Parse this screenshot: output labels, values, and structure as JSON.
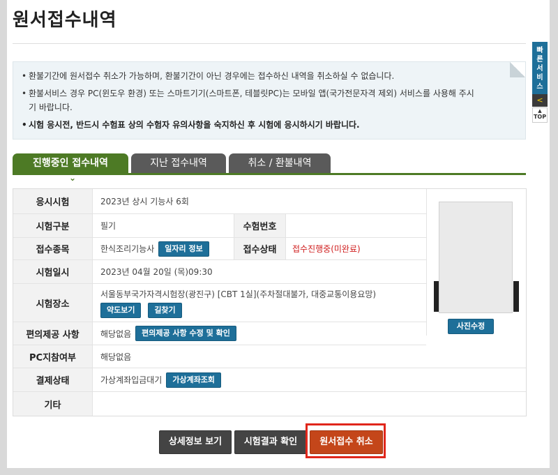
{
  "page_title": "원서접수내역",
  "notices": [
    {
      "text": "환불기간에 원서접수 취소가 가능하며, 환불기간이 아닌 경우에는 접수하신 내역을 취소하실 수 없습니다.",
      "bold": false
    },
    {
      "text": "환불서비스 경우 PC(윈도우 환경) 또는 스마트기기(스마트폰, 테블릿PC)는 모바일 앱(국가전문자격 제외) 서비스를 사용해 주시기 바랍니다.",
      "bold": false
    },
    {
      "text": "시험 응시전, 반드시 수험표 상의 수험자 유의사항을 숙지하신 후 시험에 응시하시기 바랍니다.",
      "bold": true
    }
  ],
  "tabs": [
    "진행중인 접수내역",
    "지난 접수내역",
    "취소 / 환불내역"
  ],
  "tab_arrow": "⌄",
  "rows": {
    "exam": {
      "label": "응시시험",
      "value": "2023년 상시 기능사 6회"
    },
    "category": {
      "label": "시험구분",
      "value": "필기"
    },
    "exam_number": {
      "label": "수험번호",
      "value": ""
    },
    "field": {
      "label": "접수종목",
      "value": "한식조리기능사",
      "button": "일자리 정보"
    },
    "status": {
      "label": "접수상태",
      "value": "접수진행중(미완료)"
    },
    "datetime": {
      "label": "시험일시",
      "value": "2023년 04월 20일 (목)09:30"
    },
    "location": {
      "label": "시험장소",
      "value": "서울동부국가자격시험장(광진구) [CBT 1실](주차절대불가, 대중교통이용요망)",
      "button1": "약도보기",
      "button2": "길찾기"
    },
    "convenience": {
      "label": "편의제공 사항",
      "value": "해당없음",
      "button": "편의제공 사항 수정 및 확인"
    },
    "pc": {
      "label": "PC지참여부",
      "value": "해당없음"
    },
    "payment": {
      "label": "결제상태",
      "value": "가상계좌입금대기",
      "button": "가상계좌조회"
    },
    "etc": {
      "label": "기타",
      "value": ""
    }
  },
  "photo_button": "사진수정",
  "buttons": {
    "detail": "상세정보 보기",
    "result": "시험결과 확인",
    "cancel": "원서접수 취소"
  },
  "quick_service": "빠른서비스",
  "quick_arrow": "<",
  "top_label": "TOP",
  "colors": {
    "tab_active": "#4d7a25",
    "tab_inactive": "#5a5a5a",
    "button_blue": "#1e6f99",
    "cancel_orange": "#c4461a",
    "highlight_red": "#e0261b",
    "status_red": "#d02020"
  }
}
